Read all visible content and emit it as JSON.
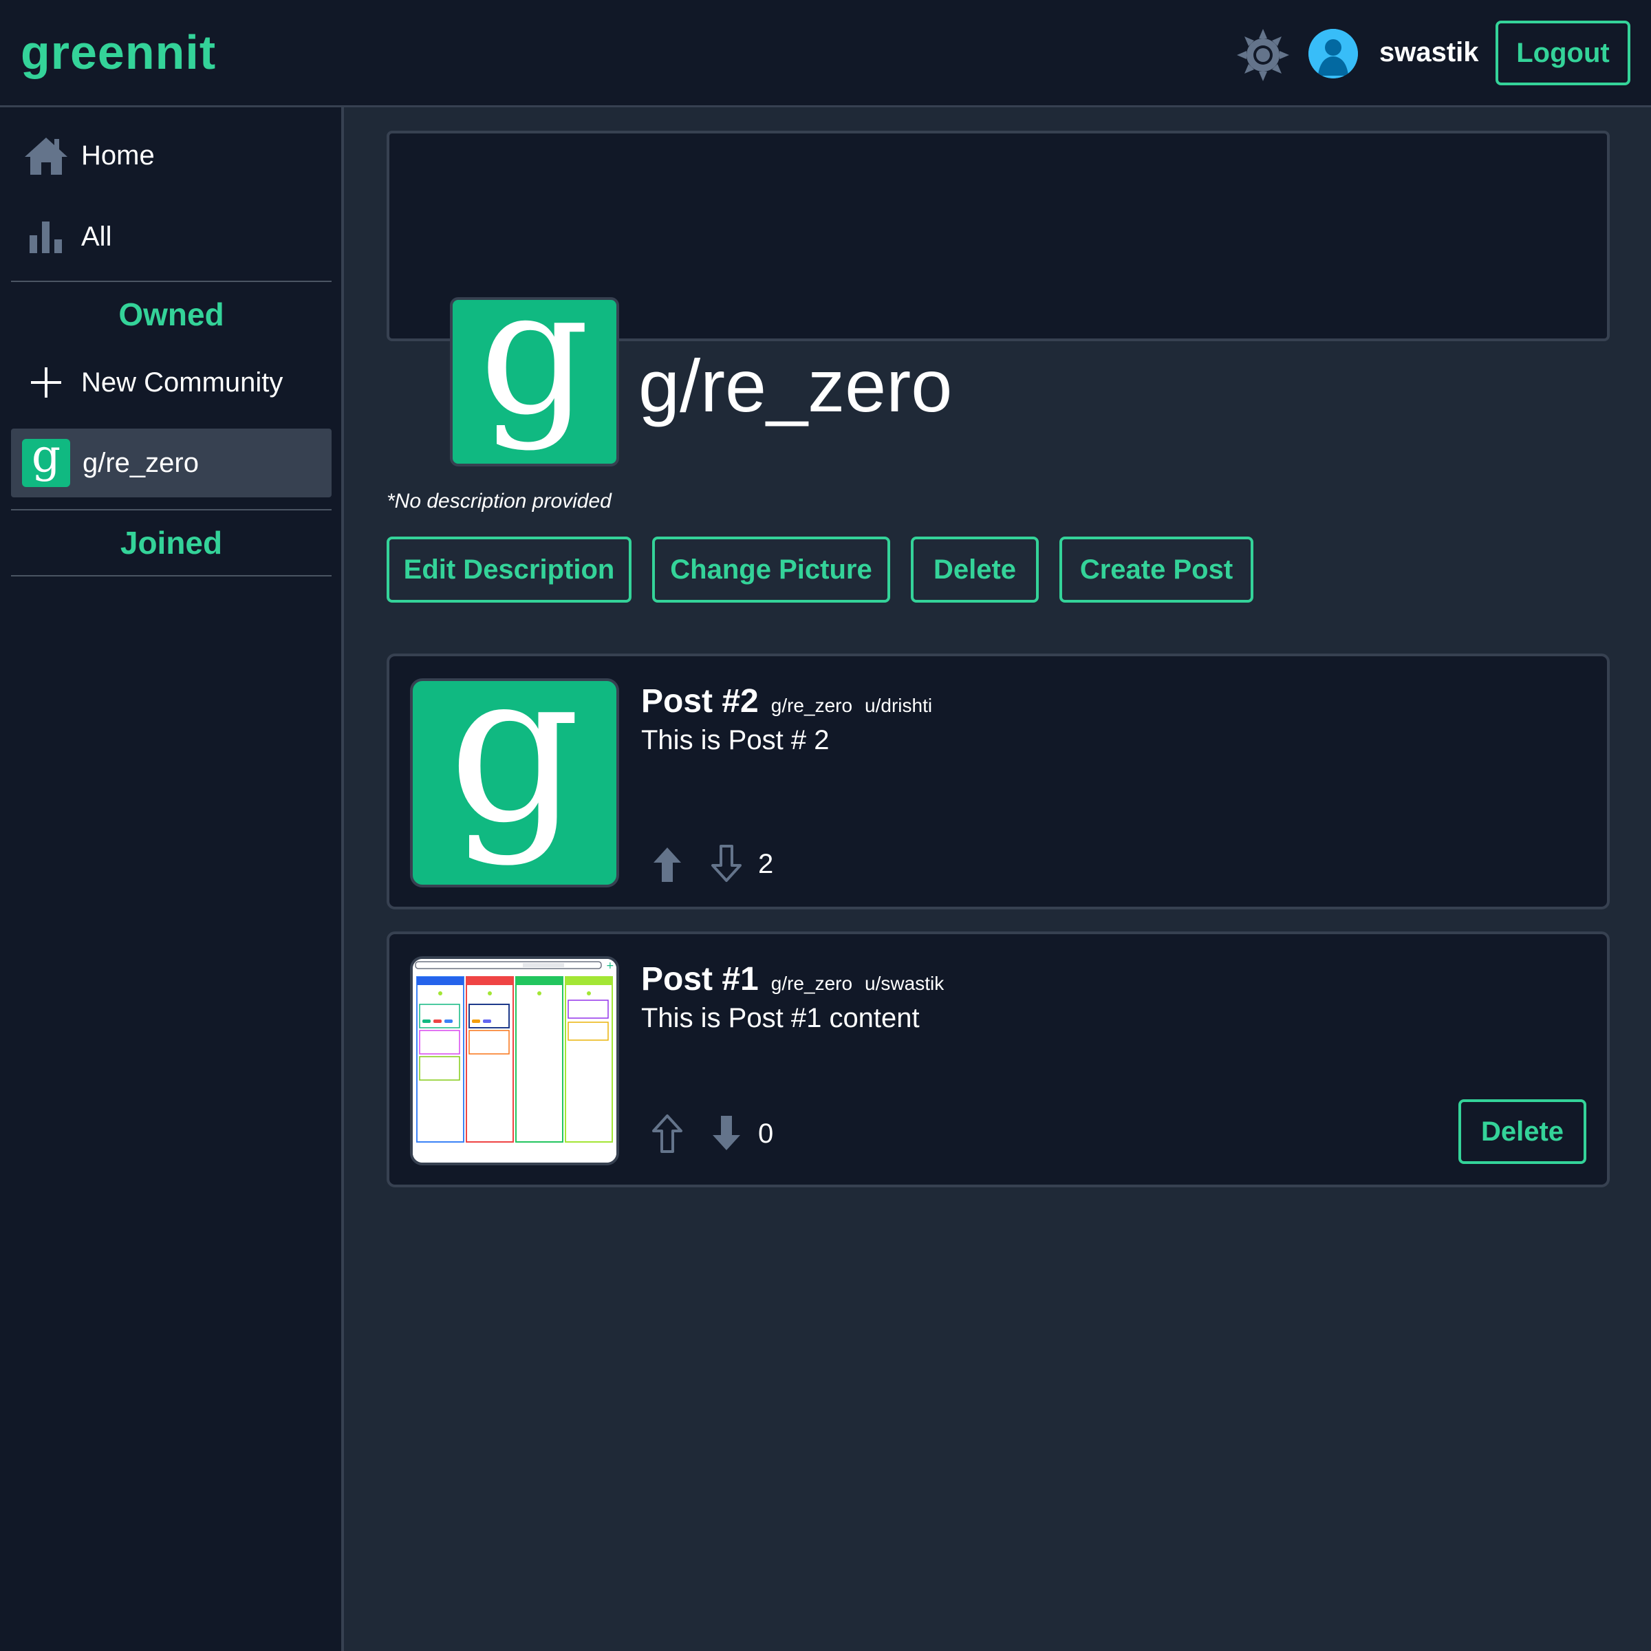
{
  "app": {
    "brand": "greennit"
  },
  "header": {
    "theme_icon": "sun-icon",
    "avatar_icon": "user-avatar-icon",
    "username": "swastik",
    "logout_label": "Logout"
  },
  "sidebar": {
    "nav": [
      {
        "label": "Home",
        "icon": "home-icon"
      },
      {
        "label": "All",
        "icon": "bar-chart-icon"
      }
    ],
    "owned_title": "Owned",
    "new_community_label": "New Community",
    "owned_communities": [
      {
        "name": "g/re_zero",
        "logo_letter": "g"
      }
    ],
    "joined_title": "Joined"
  },
  "community": {
    "logo_letter": "g",
    "name": "g/re_zero",
    "description": "*No description provided",
    "actions": {
      "edit_description": "Edit Description",
      "change_picture": "Change Picture",
      "delete": "Delete",
      "create_post": "Create Post"
    }
  },
  "posts": [
    {
      "title": "Post #2",
      "community": "g/re_zero",
      "author": "u/drishti",
      "body": "This is Post # 2",
      "score": "2",
      "thumb_letter": "g"
    },
    {
      "title": "Post #1",
      "community": "g/re_zero",
      "author": "u/swastik",
      "body": "This is Post #1 content",
      "score": "0",
      "delete_label": "Delete"
    }
  ],
  "colors": {
    "accent": "#34d399",
    "logo_bg": "#10b981",
    "panel": "#111827",
    "page": "#1f2937",
    "border": "#374151",
    "icon_gray": "#64748b"
  }
}
